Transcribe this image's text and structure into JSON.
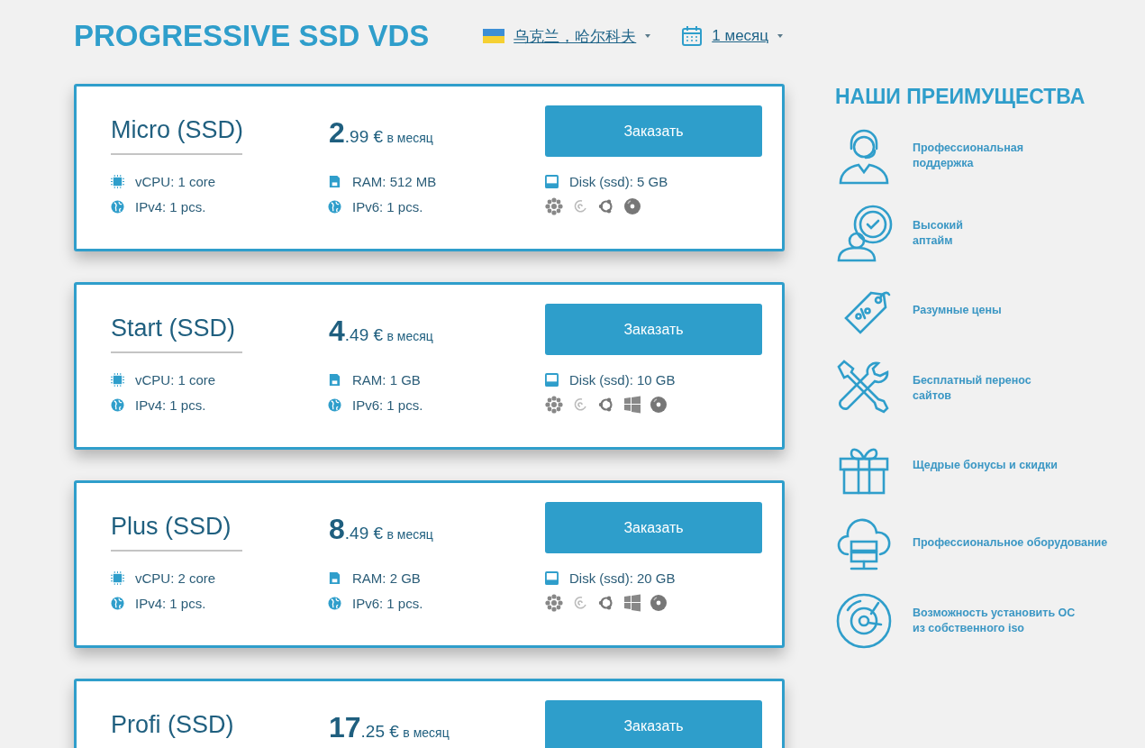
{
  "header": {
    "title": "PROGRESSIVE SSD VDS",
    "location": "乌克兰，哈尔科夫",
    "period": "1 месяц"
  },
  "plans": [
    {
      "name": "Micro (SSD)",
      "price": {
        "whole": "2",
        "fraction": ".99 €",
        "period": "в месяц"
      },
      "button": "Заказать",
      "specs": [
        {
          "kind": "cpu",
          "text": "vCPU: 1 core"
        },
        {
          "kind": "ram",
          "text": "RAM: 512 MB"
        },
        {
          "kind": "disk",
          "text": "Disk (ssd): 5 GB"
        },
        {
          "kind": "ipv4",
          "text": "IPv4: 1 pcs."
        },
        {
          "kind": "ipv6",
          "text": "IPv6: 1 pcs."
        }
      ],
      "os": [
        {
          "kind": "flower"
        },
        {
          "kind": "spiral"
        },
        {
          "kind": "ring"
        },
        {
          "kind": "disc"
        }
      ]
    },
    {
      "name": "Start (SSD)",
      "price": {
        "whole": "4",
        "fraction": ".49 €",
        "period": "в месяц"
      },
      "button": "Заказать",
      "specs": [
        {
          "kind": "cpu",
          "text": "vCPU: 1 core"
        },
        {
          "kind": "ram",
          "text": "RAM: 1 GB"
        },
        {
          "kind": "disk",
          "text": "Disk (ssd): 10 GB"
        },
        {
          "kind": "ipv4",
          "text": "IPv4: 1 pcs."
        },
        {
          "kind": "ipv6",
          "text": "IPv6: 1 pcs."
        }
      ],
      "os": [
        {
          "kind": "flower"
        },
        {
          "kind": "spiral"
        },
        {
          "kind": "ring"
        },
        {
          "kind": "windows"
        },
        {
          "kind": "disc"
        }
      ]
    },
    {
      "name": "Plus (SSD)",
      "price": {
        "whole": "8",
        "fraction": ".49 €",
        "period": "в месяц"
      },
      "button": "Заказать",
      "specs": [
        {
          "kind": "cpu",
          "text": "vCPU: 2 core"
        },
        {
          "kind": "ram",
          "text": "RAM: 2 GB"
        },
        {
          "kind": "disk",
          "text": "Disk (ssd): 20 GB"
        },
        {
          "kind": "ipv4",
          "text": "IPv4: 1 pcs."
        },
        {
          "kind": "ipv6",
          "text": "IPv6: 1 pcs."
        }
      ],
      "os": [
        {
          "kind": "flower"
        },
        {
          "kind": "spiral"
        },
        {
          "kind": "ring"
        },
        {
          "kind": "windows"
        },
        {
          "kind": "disc"
        }
      ]
    },
    {
      "name": "Profi (SSD)",
      "price": {
        "whole": "17",
        "fraction": ".25 €",
        "period": "в месяц"
      },
      "button": "Заказать"
    }
  ],
  "advantages": {
    "title": "НАШИ ПРЕИМУЩЕСТВА",
    "items": [
      {
        "kind": "support",
        "text": "Профессиональная\nподдержка"
      },
      {
        "kind": "uptime",
        "text": "Высокий\nаптайм"
      },
      {
        "kind": "price",
        "text": "Разумные цены"
      },
      {
        "kind": "tools",
        "text": "Бесплатный перенос\nсайтов"
      },
      {
        "kind": "gift",
        "text": "Щедрые бонусы и скидки"
      },
      {
        "kind": "server",
        "text": "Профессиональное оборудование"
      },
      {
        "kind": "disc",
        "text": "Возможность установить ОС\nиз собственного iso"
      }
    ]
  }
}
